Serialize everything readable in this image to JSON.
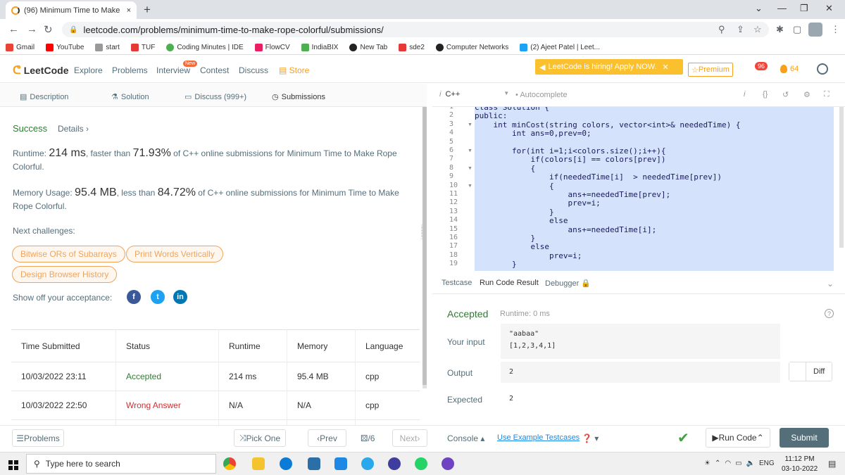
{
  "browser": {
    "tab_title": "(96) Minimum Time to Make Rop",
    "tab_close": "×",
    "new_tab": "+",
    "url": "leetcode.com/problems/minimum-time-to-make-rope-colorful/submissions/",
    "bookmarks": [
      "Gmail",
      "YouTube",
      "start",
      "TUF",
      "Coding Minutes | IDE",
      "FlowCV",
      "IndiaBIX",
      "New Tab",
      "sde2",
      "Computer Networks",
      "(2) Ajeet Patel | Leet..."
    ]
  },
  "lcnav": {
    "logo": "LeetCode",
    "links": [
      "Explore",
      "Problems",
      "Interview",
      "Contest",
      "Discuss",
      "Store"
    ],
    "new_badge": "New",
    "hiring": "LeetCode is hiring! Apply NOW.",
    "premium": "Premium",
    "notif_count": "96",
    "streak": "64"
  },
  "left_tabs": [
    "Description",
    "Solution",
    "Discuss (999+)",
    "Submissions"
  ],
  "result": {
    "success": "Success",
    "details": "Details",
    "runtime_label": "Runtime:",
    "runtime_value": "214 ms",
    "runtime_mid": ", faster than",
    "runtime_pct": "71.93%",
    "runtime_tail": "of C++ online submissions for Minimum Time to Make Rope Colorful.",
    "memory_label": "Memory Usage:",
    "memory_value": "95.4 MB",
    "memory_mid": ", less than",
    "memory_pct": "84.72%",
    "memory_tail": "of C++ online submissions for Minimum Time to Make Rope Colorful.",
    "next_challenges": "Next challenges:",
    "challenges": [
      "Bitwise ORs of Subarrays",
      "Print Words Vertically",
      "Design Browser History"
    ],
    "show_off": "Show off your acceptance:"
  },
  "table": {
    "headers": [
      "Time Submitted",
      "Status",
      "Runtime",
      "Memory",
      "Language"
    ],
    "rows": [
      [
        "10/03/2022 23:11",
        "Accepted",
        "214 ms",
        "95.4 MB",
        "cpp"
      ],
      [
        "10/03/2022 22:50",
        "Wrong Answer",
        "N/A",
        "N/A",
        "cpp"
      ]
    ]
  },
  "editor": {
    "language": "C++",
    "autocomplete": "Autocomplete",
    "line_numbers": [
      "1",
      "2",
      "3",
      "4",
      "5",
      "6",
      "7",
      "8",
      "9",
      "10",
      "11",
      "12",
      "13",
      "14",
      "15",
      "16",
      "17",
      "18",
      "19"
    ],
    "lines": [
      "class Solution {",
      "public:",
      "    int minCost(string colors, vector<int>& neededTime) {",
      "        int ans=0,prev=0;",
      "",
      "        for(int i=1;i<colors.size();i++){",
      "            if(colors[i] == colors[prev])",
      "            {",
      "                if(neededTime[i]  > neededTime[prev])",
      "                {",
      "                    ans+=neededTime[prev];",
      "                    prev=i;",
      "                }",
      "                else",
      "                    ans+=neededTime[i];",
      "            }",
      "            else",
      "                prev=i;",
      "        }"
    ]
  },
  "run": {
    "tabs": [
      "Testcase",
      "Run Code Result",
      "Debugger"
    ],
    "status": "Accepted",
    "runtime": "Runtime: 0 ms",
    "input_label": "Your input",
    "input_lines": [
      "\"aabaa\"",
      "[1,2,3,4,1]"
    ],
    "output_label": "Output",
    "output": "2",
    "expected_label": "Expected",
    "expected": "2",
    "diff": "Diff"
  },
  "bottom": {
    "problems": "Problems",
    "pick_one": "Pick One",
    "prev": "Prev",
    "page": "/6",
    "next": "Next",
    "console": "Console",
    "example": "Use Example Testcases",
    "run_code": "Run Code",
    "submit": "Submit"
  },
  "taskbar": {
    "search": "Type here to search",
    "lang": "ENG",
    "time": "11:12 PM",
    "date": "03-10-2022"
  },
  "colors": {
    "accent": "#f89f1b",
    "success": "#2e7d32",
    "error": "#d32f2f",
    "editor_selection": "#d4e3fb"
  }
}
